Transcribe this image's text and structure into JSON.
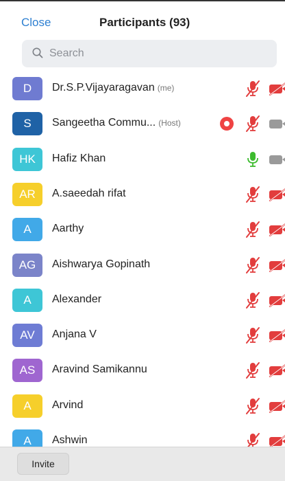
{
  "header": {
    "close_label": "Close",
    "title": "Participants (93)"
  },
  "search": {
    "placeholder": "Search",
    "value": ""
  },
  "colors": {
    "link": "#2d7fd1",
    "muted_red": "#e23d3d",
    "mic_on_green": "#3cbb2e",
    "camera_off_gray": "#9a9a9a",
    "record_red": "#ef4343"
  },
  "participants": [
    {
      "initials": "D",
      "name": "Dr.S.P.Vijayaragavan",
      "tag": "(me)",
      "color": "#6f7bd1",
      "mic": "muted",
      "camera": "off-red",
      "recording": false
    },
    {
      "initials": "S",
      "name": "Sangeetha Commu...",
      "tag": "(Host)",
      "color": "#1f62a6",
      "mic": "muted",
      "camera": "off-gray",
      "recording": true
    },
    {
      "initials": "HK",
      "name": "Hafiz Khan",
      "tag": "",
      "color": "#3ec6d6",
      "mic": "on",
      "camera": "off-gray",
      "recording": false
    },
    {
      "initials": "AR",
      "name": "A.saeedah rifat",
      "tag": "",
      "color": "#f6cf2b",
      "mic": "muted",
      "camera": "off-red",
      "recording": false
    },
    {
      "initials": "A",
      "name": "Aarthy",
      "tag": "",
      "color": "#41a9e8",
      "mic": "muted",
      "camera": "off-red",
      "recording": false
    },
    {
      "initials": "AG",
      "name": "Aishwarya Gopinath",
      "tag": "",
      "color": "#7b84c9",
      "mic": "muted",
      "camera": "off-red",
      "recording": false
    },
    {
      "initials": "A",
      "name": "Alexander",
      "tag": "",
      "color": "#3ec6d6",
      "mic": "muted",
      "camera": "off-red",
      "recording": false
    },
    {
      "initials": "AV",
      "name": "Anjana V",
      "tag": "",
      "color": "#6e7cd4",
      "mic": "muted",
      "camera": "off-red",
      "recording": false
    },
    {
      "initials": "AS",
      "name": "Aravind Samikannu",
      "tag": "",
      "color": "#9f66d0",
      "mic": "muted",
      "camera": "off-red",
      "recording": false
    },
    {
      "initials": "A",
      "name": "Arvind",
      "tag": "",
      "color": "#f6cf2b",
      "mic": "muted",
      "camera": "off-red",
      "recording": false
    },
    {
      "initials": "A",
      "name": "Ashwin",
      "tag": "",
      "color": "#41a9e8",
      "mic": "muted",
      "camera": "off-red",
      "recording": false
    }
  ],
  "footer": {
    "invite_label": "Invite"
  }
}
